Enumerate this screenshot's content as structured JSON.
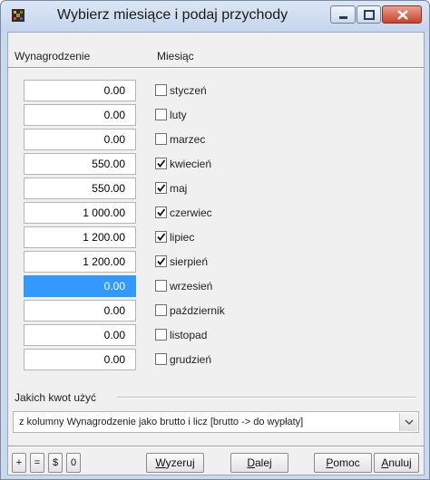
{
  "window": {
    "title": "Wybierz miesiące i podaj przychody"
  },
  "columns": {
    "amount_header": "Wynagrodzenie",
    "month_header": "Miesiąc"
  },
  "rows": [
    {
      "amount": "0.00",
      "month": "styczeń",
      "checked": false
    },
    {
      "amount": "0.00",
      "month": "luty",
      "checked": false
    },
    {
      "amount": "0.00",
      "month": "marzec",
      "checked": false
    },
    {
      "amount": "550.00",
      "month": "kwiecień",
      "checked": true
    },
    {
      "amount": "550.00",
      "month": "maj",
      "checked": true
    },
    {
      "amount": "1 000.00",
      "month": "czerwiec",
      "checked": true
    },
    {
      "amount": "1 200.00",
      "month": "lipiec",
      "checked": true
    },
    {
      "amount": "1 200.00",
      "month": "sierpień",
      "checked": true
    },
    {
      "amount": "0.00",
      "month": "wrzesień",
      "checked": false,
      "selected": true
    },
    {
      "amount": "0.00",
      "month": "październik",
      "checked": false
    },
    {
      "amount": "0.00",
      "month": "listopad",
      "checked": false
    },
    {
      "amount": "0.00",
      "month": "grudzień",
      "checked": false
    }
  ],
  "group": {
    "label": "Jakich kwot użyć",
    "selected_option": "z kolumny Wynagrodzenie jako brutto i licz [brutto -> do wypłaty]"
  },
  "toolbar": {
    "add_symbol": "+",
    "remove_symbol": "=",
    "dollar_label": "$",
    "zero_label": "0",
    "reset": {
      "ul": "W",
      "rest": "yzeruj"
    },
    "next": {
      "ul": "D",
      "rest": "alej"
    },
    "help": {
      "ul": "P",
      "rest": "omoc"
    },
    "cancel": {
      "ul": "A",
      "rest": "nuluj"
    }
  },
  "colors": {
    "selection": "#3399ff",
    "titlebar": "#c4d5ec",
    "close_button": "#c7412b"
  }
}
